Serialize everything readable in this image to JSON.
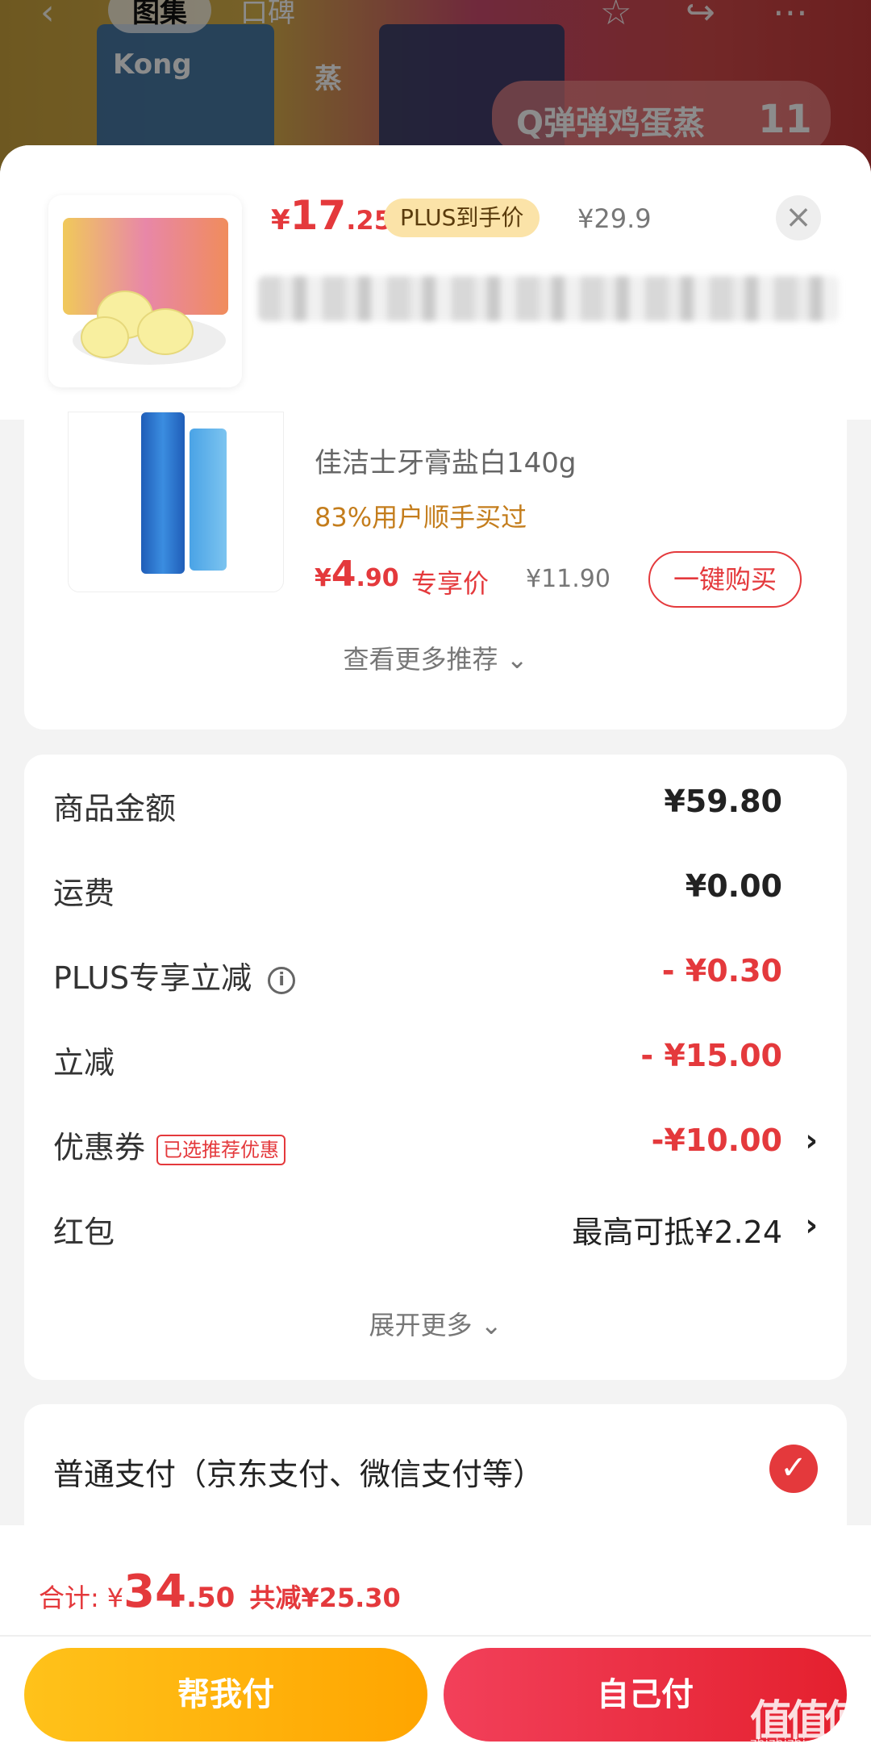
{
  "background": {
    "tabs": [
      "图集",
      "口碑"
    ],
    "brand_logo": "Kong",
    "box_text": "蒸",
    "banner_text": "Q弹弹鸡蛋蒸",
    "banner_number": "11"
  },
  "sheet": {
    "price": {
      "symbol": "¥",
      "integer": "17",
      "decimal": ".25"
    },
    "plus_badge": "PLUS到手价",
    "original_price": "¥29.9",
    "close_icon": "×"
  },
  "recommendation": {
    "name": "佳洁士牙膏盐白140g",
    "subtitle": "83%用户顺手买过",
    "price": {
      "symbol": "¥",
      "integer": "4",
      "decimal": ".90"
    },
    "price_tag": "专享价",
    "original_price": "¥11.90",
    "buy_button": "一键购买",
    "see_more": "查看更多推荐"
  },
  "summary": {
    "rows": [
      {
        "label": "商品金额",
        "value": "¥59.80"
      },
      {
        "label": "运费",
        "value": "¥0.00"
      },
      {
        "label": "PLUS专享立减",
        "value": "- ¥0.30"
      },
      {
        "label": "立减",
        "value": "- ¥15.00"
      },
      {
        "label": "优惠券",
        "tag": "已选推荐优惠",
        "value": "-¥10.00"
      },
      {
        "label": "红包",
        "value": "最高可抵¥2.24"
      }
    ],
    "expand": "展开更多"
  },
  "payment": {
    "method": "普通支付（京东支付、微信支付等）"
  },
  "footer": {
    "total_label": "合计:",
    "total": {
      "symbol": "¥",
      "integer": "34",
      "decimal": ".50"
    },
    "saved": "共减¥25.30",
    "help_pay": "帮我付",
    "self_pay": "自己付"
  },
  "watermark": {
    "logo": "值值值",
    "url": "zhizhizhi.com"
  },
  "colors": {
    "accent": "#e4393c",
    "plus_badge_bg": "#fbe3a8",
    "help_button": "#ffb300"
  }
}
